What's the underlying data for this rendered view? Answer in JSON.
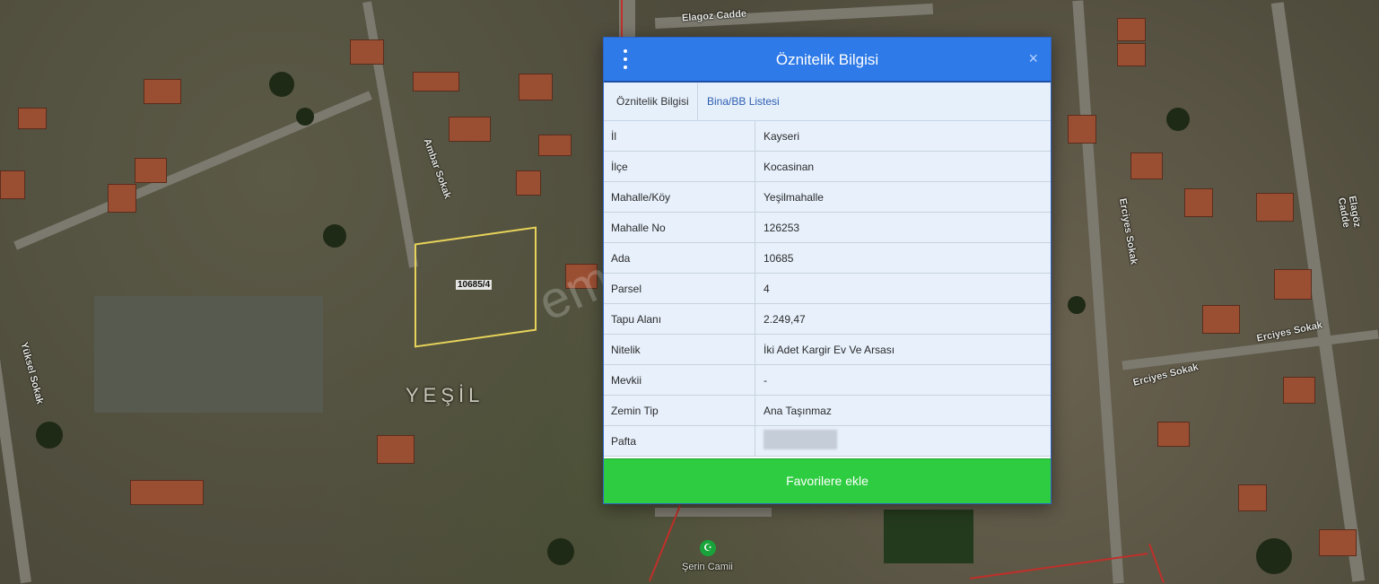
{
  "dialog": {
    "title": "Öznitelik Bilgisi",
    "menu_icon": "menu-dots-icon",
    "close_icon": "close-icon",
    "close_label": "×",
    "tabs": [
      {
        "label": "Öznitelik Bilgisi"
      },
      {
        "label": "Bina/BB Listesi"
      }
    ],
    "rows": [
      {
        "key": "İl",
        "value": "Kayseri"
      },
      {
        "key": "İlçe",
        "value": "Kocasinan"
      },
      {
        "key": "Mahalle/Köy",
        "value": "Yeşilmahalle"
      },
      {
        "key": "Mahalle No",
        "value": "126253"
      },
      {
        "key": "Ada",
        "value": "10685"
      },
      {
        "key": "Parsel",
        "value": "4"
      },
      {
        "key": "Tapu Alanı",
        "value": "2.249,47"
      },
      {
        "key": "Nitelik",
        "value": "İki Adet Kargir Ev Ve Arsası"
      },
      {
        "key": "Mevkii",
        "value": "-"
      },
      {
        "key": "Zemin Tip",
        "value": "Ana Taşınmaz"
      },
      {
        "key": "Pafta",
        "value": ""
      }
    ],
    "favorite_button": "Favorilere ekle"
  },
  "map": {
    "labels": {
      "elagoz_top": "Elagoz Cadde",
      "elagoz_right": "Elagöz Cadde",
      "ambar": "Ambar Sokak",
      "ercyes1": "Erciyes Sokak",
      "ercyes2": "Erciyes Sokak",
      "ercyes3": "Erciyes Sokak",
      "yuksel": "Yüksel Sokak",
      "district": "YEŞİL",
      "parcel": "10685/4",
      "mosque": "Şerin Camii"
    },
    "watermark": "emlakjet.com",
    "mosque_icon": "mosque-icon",
    "mosque_glyph": "☪"
  }
}
